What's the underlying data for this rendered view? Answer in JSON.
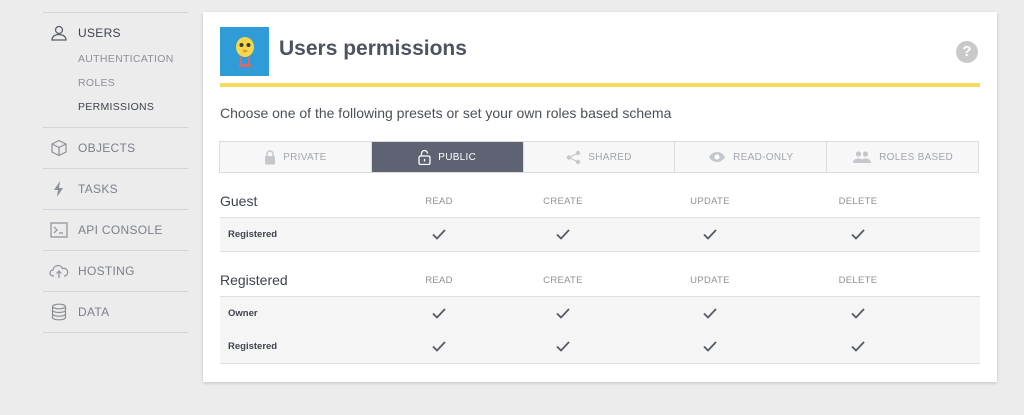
{
  "sidebar": {
    "users": {
      "label": "USERS",
      "sub": [
        "AUTHENTICATION",
        "ROLES",
        "PERMISSIONS"
      ]
    },
    "items": [
      "OBJECTS",
      "TASKS",
      "API CONSOLE",
      "HOSTING",
      "DATA"
    ]
  },
  "header": {
    "title": "Users permissions",
    "help": "?"
  },
  "subtitle": "Choose one of the following presets or set your own roles based schema",
  "tabs": [
    "PRIVATE",
    "PUBLIC",
    "SHARED",
    "READ-ONLY",
    "ROLES BASED"
  ],
  "columns": [
    "READ",
    "CREATE",
    "UPDATE",
    "DELETE"
  ],
  "groups": [
    {
      "name": "Guest",
      "rows": [
        "Registered"
      ]
    },
    {
      "name": "Registered",
      "rows": [
        "Owner",
        "Registered"
      ]
    }
  ],
  "colors": {
    "accent": "#f7dd5b",
    "active_tab": "#5f6272",
    "logo_bg": "#2f9bd7"
  }
}
